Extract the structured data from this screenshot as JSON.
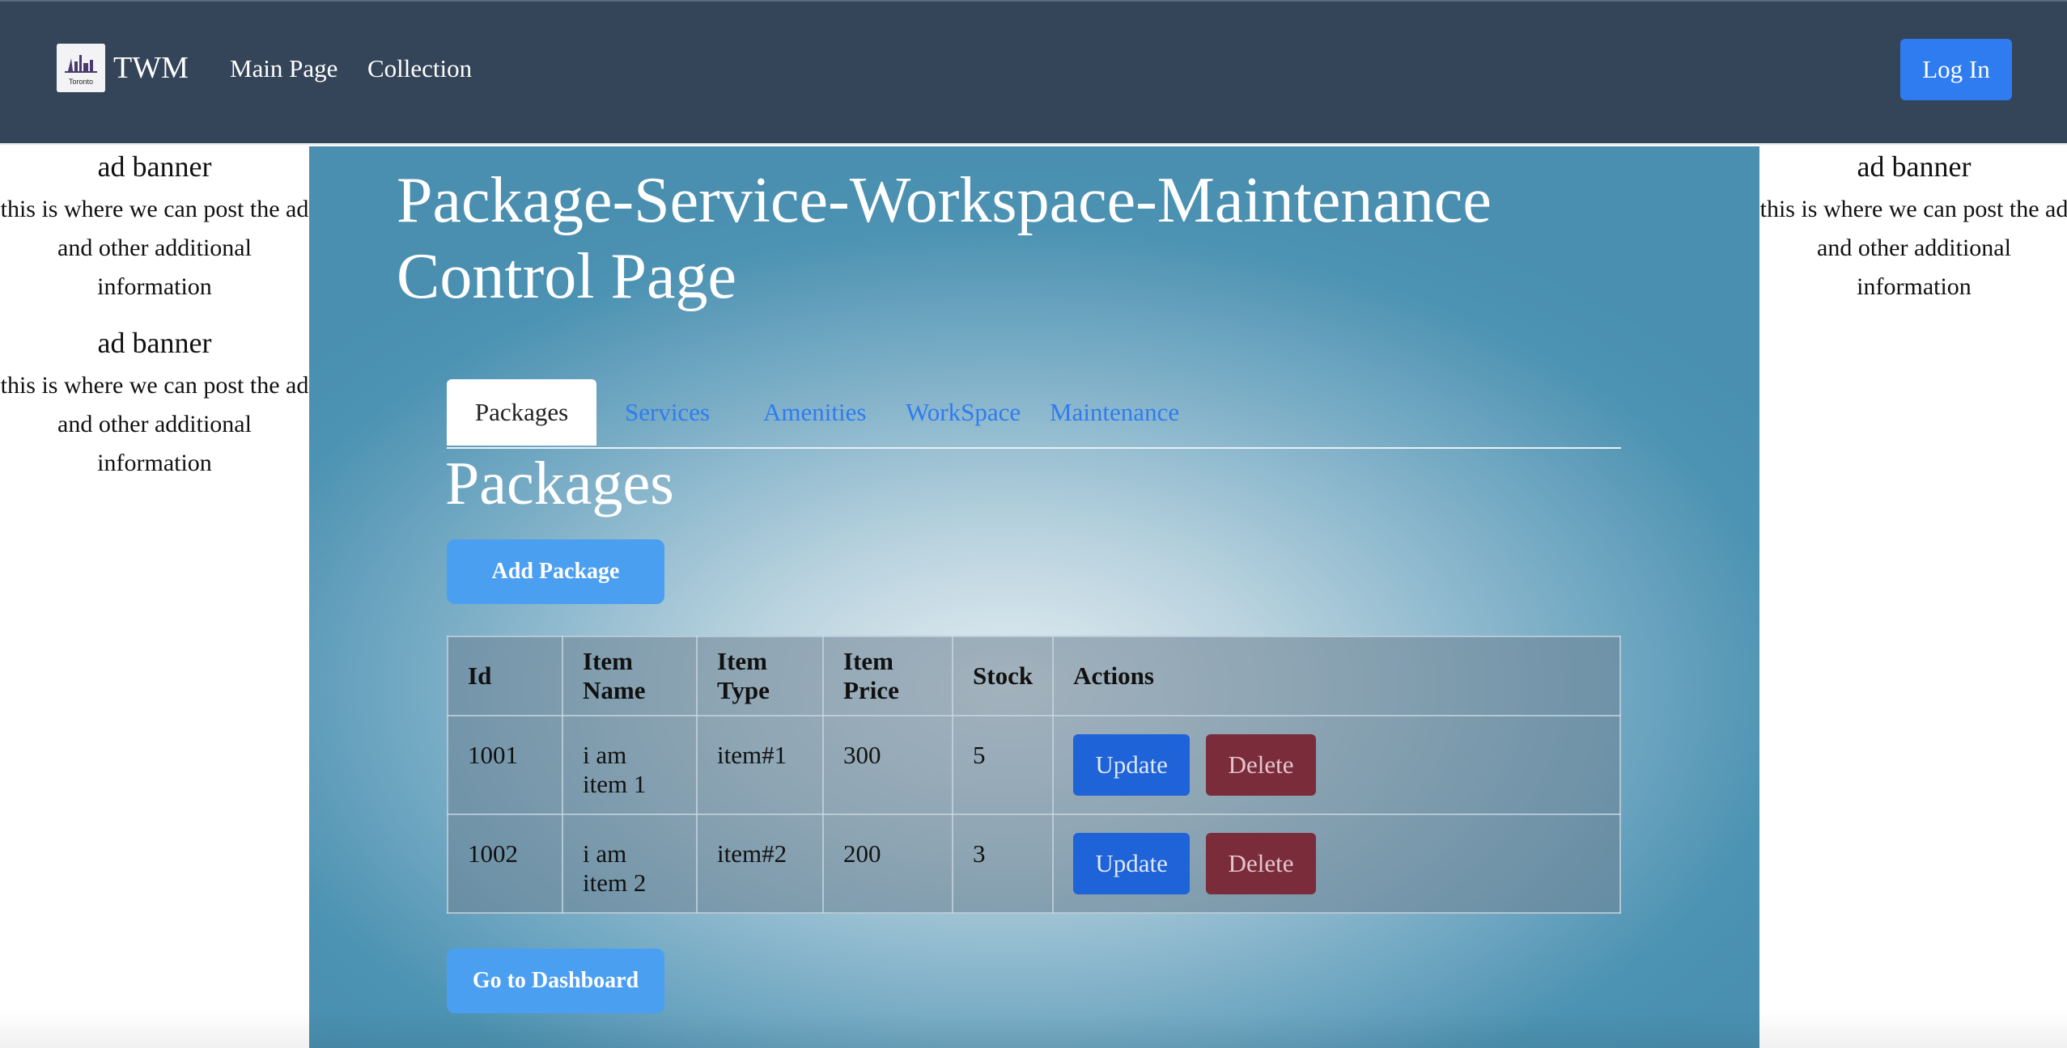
{
  "navbar": {
    "logo_text": "Toronto",
    "brand": "TWM",
    "links": [
      "Main Page",
      "Collection"
    ],
    "login_label": "Log In"
  },
  "ads": {
    "title": "ad banner",
    "text": "this is where we can post the ad and other additional information"
  },
  "main": {
    "page_title": "Package-Service-Workspace-Maintenance Control Page",
    "tabs": [
      "Packages",
      "Services",
      "Amenities",
      "WorkSpace",
      "Maintenance"
    ],
    "active_tab": "Packages",
    "section_title": "Packages",
    "add_button": "Add Package",
    "dashboard_button": "Go to Dashboard"
  },
  "table": {
    "headers": [
      "Id",
      "Item Name",
      "Item Type",
      "Item Price",
      "Stock",
      "Actions"
    ],
    "rows": [
      {
        "id": "1001",
        "name": "i am item 1",
        "type": "item#1",
        "price": "300",
        "stock": "5"
      },
      {
        "id": "1002",
        "name": "i am item 2",
        "type": "item#2",
        "price": "200",
        "stock": "3"
      }
    ],
    "update_label": "Update",
    "delete_label": "Delete"
  },
  "colors": {
    "navbar": "#344459",
    "primary": "#2e7cf0",
    "button_blue": "#4b9ff0",
    "delete": "#7a2c3a"
  }
}
